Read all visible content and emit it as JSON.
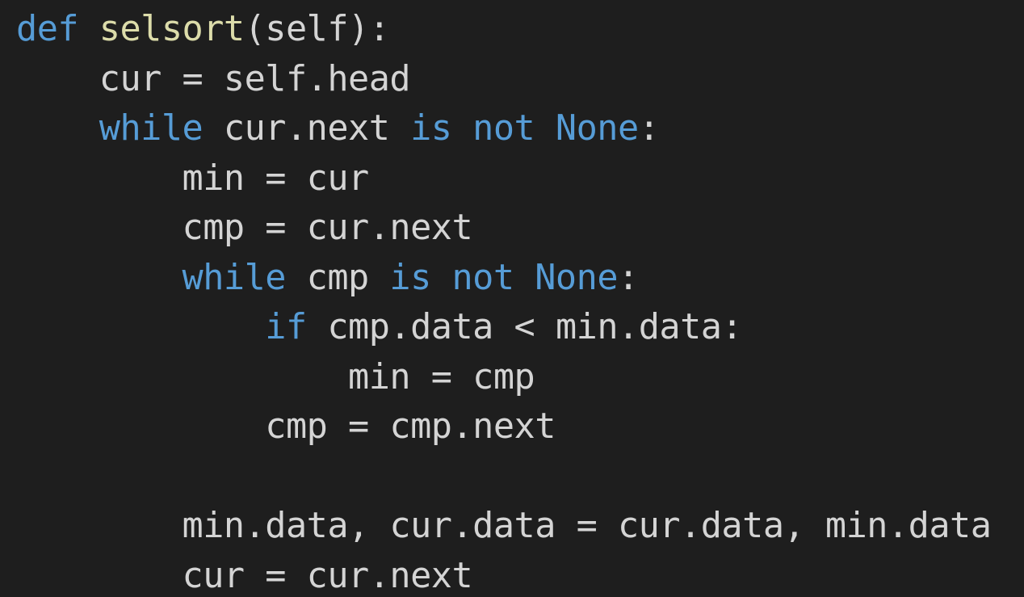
{
  "editor": {
    "theme": {
      "background": "#1e1e1e",
      "keyword": "#569cd6",
      "function_name": "#dcdcaa",
      "identifier": "#d4d4d4"
    },
    "lines": [
      {
        "indent": "",
        "tokens": [
          {
            "type": "kw",
            "text": "def "
          },
          {
            "type": "name",
            "text": "selsort"
          },
          {
            "type": "plain",
            "text": "(self):"
          }
        ]
      },
      {
        "indent": "    ",
        "tokens": [
          {
            "type": "plain",
            "text": "cur = self.head"
          }
        ]
      },
      {
        "indent": "    ",
        "tokens": [
          {
            "type": "kw",
            "text": "while "
          },
          {
            "type": "plain",
            "text": "cur.next "
          },
          {
            "type": "kw",
            "text": "is not None"
          },
          {
            "type": "plain",
            "text": ":"
          }
        ]
      },
      {
        "indent": "        ",
        "tokens": [
          {
            "type": "plain",
            "text": "min = cur"
          }
        ]
      },
      {
        "indent": "        ",
        "tokens": [
          {
            "type": "plain",
            "text": "cmp = cur.next"
          }
        ]
      },
      {
        "indent": "        ",
        "tokens": [
          {
            "type": "kw",
            "text": "while "
          },
          {
            "type": "plain",
            "text": "cmp "
          },
          {
            "type": "kw",
            "text": "is not None"
          },
          {
            "type": "plain",
            "text": ":"
          }
        ]
      },
      {
        "indent": "            ",
        "tokens": [
          {
            "type": "kw",
            "text": "if "
          },
          {
            "type": "plain",
            "text": "cmp.data < min.data:"
          }
        ]
      },
      {
        "indent": "                ",
        "tokens": [
          {
            "type": "plain",
            "text": "min = cmp"
          }
        ]
      },
      {
        "indent": "            ",
        "tokens": [
          {
            "type": "plain",
            "text": "cmp = cmp.next"
          }
        ]
      },
      {
        "indent": "",
        "tokens": []
      },
      {
        "indent": "        ",
        "tokens": [
          {
            "type": "plain",
            "text": "min.data, cur.data = cur.data, min.data"
          }
        ]
      },
      {
        "indent": "        ",
        "tokens": [
          {
            "type": "plain",
            "text": "cur = cur.next"
          }
        ]
      }
    ]
  }
}
